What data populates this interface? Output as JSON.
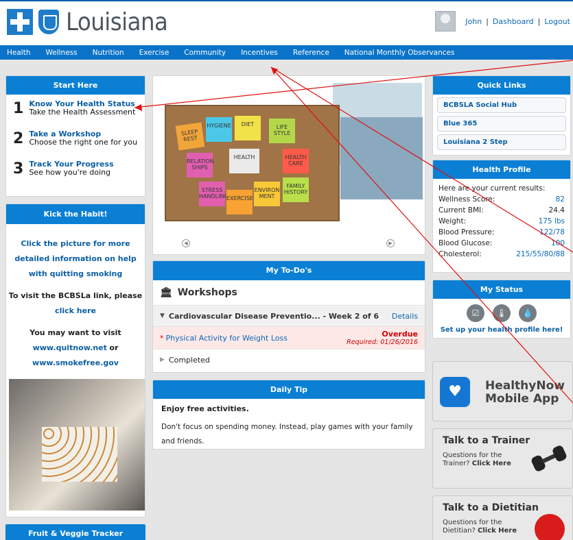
{
  "header": {
    "brand": "Louisiana",
    "user_name": "John",
    "dashboard_link": "Dashboard",
    "logout_link": "Logout",
    "separator": "|"
  },
  "nav": {
    "items": [
      "Health",
      "Wellness",
      "Nutrition",
      "Exercise",
      "Community",
      "Incentives",
      "Reference",
      "National Monthly Observances"
    ]
  },
  "start_here": {
    "title": "Start Here",
    "steps": [
      {
        "num": "1",
        "title": "Know Your Health Status",
        "sub": "Take the Health Assessment"
      },
      {
        "num": "2",
        "title": "Take a Workshop",
        "sub": "Choose the right one for you"
      },
      {
        "num": "3",
        "title": "Track Your Progress",
        "sub": "See how you're doing"
      }
    ]
  },
  "kick": {
    "title": "Kick the Habit!",
    "line1": "Click the picture for more detailed information on help with quitting smoking",
    "line2": "To visit the BCBSLa link, please",
    "line2_link": "click here",
    "line3": "You may want to visit",
    "link_quitnow": "www.quitnow.net",
    "or": "or",
    "link_smokefree": "www.smokefree.gov"
  },
  "fruit": {
    "title": "Fruit & Veggie Tracker"
  },
  "slides": {
    "notes": [
      "SLEEP REST",
      "HYGIENE",
      "DIET",
      "LIFE STYLE",
      "RELATION SHIPS",
      "HEALTH",
      "HEALTH CARE",
      "STRESS HANDLING",
      "EXERCISE",
      "ENVIRON MENT",
      "FAMILY HISTORY"
    ]
  },
  "todos": {
    "title": "My To-Do's",
    "workshops_label": "Workshops",
    "item1": "Cardiovascular Disease Preventio... - Week 2 of 6",
    "item1_link": "Details",
    "item2": "Physical Activity for Weight Loss",
    "item2_status": "Overdue",
    "item2_required": "Required: 01/26/2016",
    "completed": "Completed"
  },
  "tip": {
    "title": "Daily Tip",
    "heading": "Enjoy free activities.",
    "body": "Don't focus on spending money. Instead, play games with your family and friends."
  },
  "quick_links": {
    "title": "Quick Links",
    "items": [
      "BCBSLA Social Hub",
      "Blue 365",
      "Louisiana 2 Step"
    ]
  },
  "health_profile": {
    "title": "Health Profile",
    "intro": "Here are your current results:",
    "rows": [
      {
        "label": "Wellness Score:",
        "value": "82"
      },
      {
        "label": "Current BMI:",
        "value": "24.4"
      },
      {
        "label": "Weight:",
        "value": "175 lbs"
      },
      {
        "label": "Blood Pressure:",
        "value": "122/78"
      },
      {
        "label": "Blood Glucose:",
        "value": "100"
      },
      {
        "label": "Cholesterol:",
        "value": "215/55/80/88"
      }
    ]
  },
  "my_status": {
    "title": "My Status",
    "link": "Set up your health profile here!"
  },
  "promos": {
    "healthy_title": "HealthyNow",
    "healthy_sub": "Mobile App",
    "trainer_title": "Talk to a Trainer",
    "trainer_sub1": "Questions for the",
    "trainer_sub2": "Trainer?",
    "trainer_link": "Click Here",
    "dietitian_title": "Talk to a Dietitian",
    "dietitian_sub1": "Questions for the",
    "dietitian_sub2": "Dietitian?",
    "dietitian_link": "Click Here"
  }
}
